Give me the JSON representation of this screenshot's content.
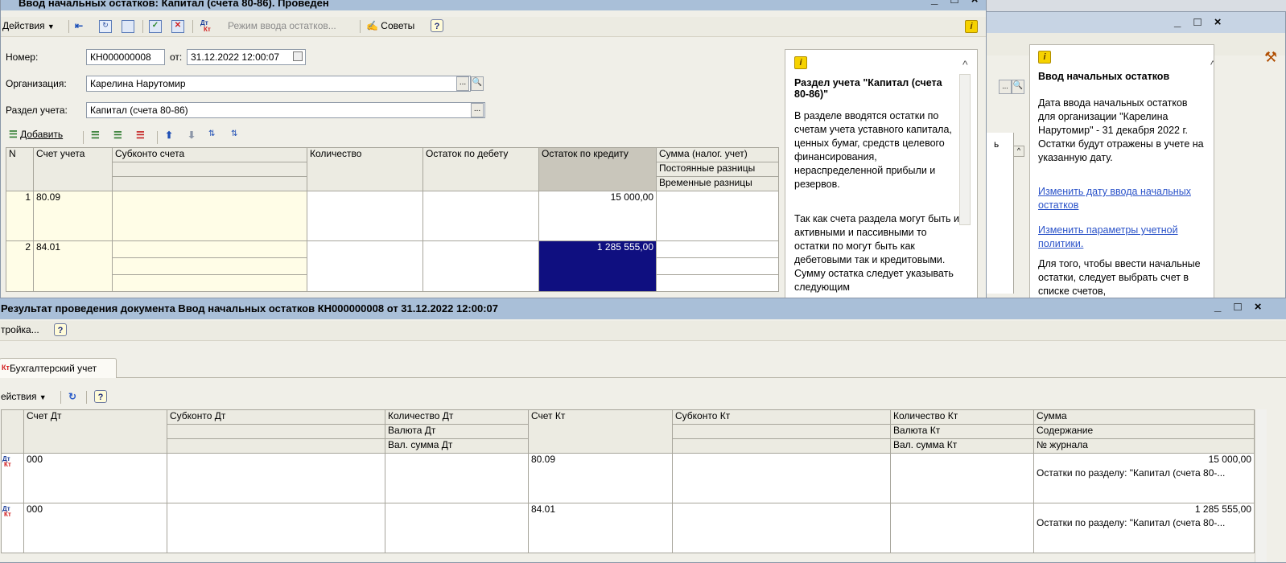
{
  "bg_window": {
    "controls": "_ □ ×",
    "panel_title": "Ввод начальных остатков",
    "panel_text_1": "Дата ввода начальных остатков для организации \"Карелина Нарутомир\" - 31 декабря 2022 г. Остатки будут отражены в учете на указанную дату.",
    "link_1": "Изменить дату ввода начальных остатков",
    "link_2": "Изменить параметры учетной политики.",
    "panel_text_2": "Для того, чтобы ввести начальные остатки, следует выбрать счет в списке счетов,",
    "partial_col_label": "ь"
  },
  "doc_window": {
    "title": "Ввод начальных остатков: Капитал (счета 80-86). Проведен",
    "controls": "_ □ ×",
    "toolbar": {
      "actions_label": "Действия",
      "mode_label": "Режим ввода остатков...",
      "tips_label": "Советы",
      "help_label": "?"
    },
    "form": {
      "number_label": "Номер:",
      "number_value": "КН000000008",
      "date_label": "от:",
      "date_value": "31.12.2022 12:00:07",
      "org_label": "Организация:",
      "org_value": "Карелина Нарутомир",
      "section_label": "Раздел учета:",
      "section_value": "Капитал (счета 80-86)"
    },
    "table_toolbar": {
      "add_label": "Добавить"
    },
    "table": {
      "headers": {
        "n": "N",
        "account": "Счет учета",
        "subconto": "Субконто счета",
        "quantity": "Количество",
        "debit": "Остаток по дебету",
        "credit": "Остаток по кредиту",
        "tax_sum": "Сумма (налог. учет)",
        "perm_diff": "Постоянные разницы",
        "temp_diff": "Временные разницы"
      },
      "rows": [
        {
          "n": "1",
          "account": "80.09",
          "credit": "15 000,00"
        },
        {
          "n": "2",
          "account": "84.01",
          "credit": "1 285 555,00"
        }
      ]
    },
    "panel": {
      "title": "Раздел учета \"Капитал (счета 80-86)\"",
      "text_1": "В разделе вводятся остатки по счетам учета уставного капитала, ценных бумаг, средств целевого финансирования, нераспределенной прибыли и резервов.",
      "text_2": "Так как счета раздела могут быть и активными и пассивными то остатки по могут быть как дебетовыми так и кредитовыми. Сумму остатка следует указывать следующим"
    }
  },
  "result_window": {
    "title": "Результат проведения документа Ввод начальных остатков КН000000008 от 31.12.2022 12:00:07",
    "controls": "_ □ ×",
    "toolbar": {
      "settings_label": "тройка...",
      "help_label": "?"
    },
    "tab_label": "Бухгалтерский учет",
    "actions_label": "ействия",
    "table": {
      "headers": {
        "acc_dt": "Счет Дт",
        "sub_dt": "Субконто Дт",
        "qty_dt": "Количество Дт",
        "cur_dt": "Валюта Дт",
        "cursum_dt": "Вал. сумма Дт",
        "acc_kt": "Счет Кт",
        "sub_kt": "Субконто Кт",
        "qty_kt": "Количество Кт",
        "cur_kt": "Валюта Кт",
        "cursum_kt": "Вал. сумма Кт",
        "sum": "Сумма",
        "content": "Содержание",
        "journal": "№ журнала"
      },
      "rows": [
        {
          "acc_dt": "000",
          "acc_kt": "80.09",
          "sum": "15 000,00",
          "content": "Остатки по разделу: \"Капитал (счета 80-..."
        },
        {
          "acc_dt": "000",
          "acc_kt": "84.01",
          "sum": "1 285 555,00",
          "content": "Остатки по разделу: \"Капитал (счета 80-..."
        }
      ],
      "row_icon_top": "Дт",
      "row_icon_bottom": "Кт"
    }
  },
  "colors": {
    "title_bar": "#a9bfd8",
    "selection": "#0f0f80",
    "link": "#2b53c9"
  }
}
